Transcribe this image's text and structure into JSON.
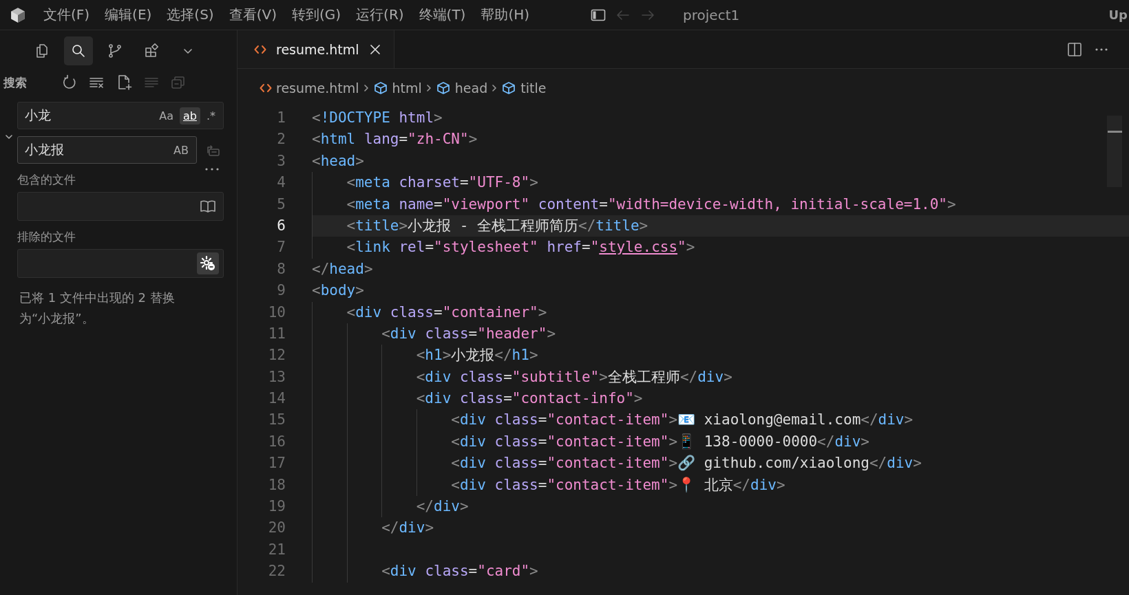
{
  "menu_bar": {
    "items": [
      "文件(F)",
      "编辑(E)",
      "选择(S)",
      "查看(V)",
      "转到(G)",
      "运行(R)",
      "终端(T)",
      "帮助(H)"
    ],
    "nav": [
      {
        "kind": "sidebar",
        "disabled": false
      },
      {
        "kind": "back",
        "disabled": true
      },
      {
        "kind": "forward",
        "disabled": true
      }
    ],
    "title": "project1",
    "account": "Up"
  },
  "activity_bar": [
    {
      "kind": "explorer",
      "selected": false
    },
    {
      "kind": "search",
      "selected": true
    },
    {
      "kind": "source_control",
      "selected": false
    },
    {
      "kind": "extensions",
      "selected": false
    },
    {
      "kind": "more",
      "selected": false
    }
  ],
  "search_panel": {
    "title": "搜索",
    "actions": [
      {
        "kind": "refresh",
        "disabled": false
      },
      {
        "kind": "clear",
        "disabled": false
      },
      {
        "kind": "new_file",
        "disabled": false
      },
      {
        "kind": "collapse",
        "disabled": true
      },
      {
        "kind": "expand",
        "disabled": true
      }
    ],
    "replace_expanded": true,
    "search": {
      "value": "小龙",
      "options": [
        {
          "label": "Aa",
          "on": false
        },
        {
          "label": "ab",
          "on": true
        },
        {
          "label": ".*",
          "on": false
        }
      ]
    },
    "replace": {
      "value": "小龙报",
      "options": [
        {
          "label": "AB",
          "on": false
        }
      ],
      "replace_all_disabled": true
    },
    "include": {
      "label": "包含的文件",
      "open_editors_only": false
    },
    "exclude": {
      "label": "排除的文件",
      "use_exclude_settings": true
    },
    "message": "已将 1 文件中出现的 2 替换为“小龙报”。"
  },
  "editor": {
    "tabs": [
      {
        "label": "resume.html",
        "selected": true
      }
    ],
    "breadcrumbs": [
      {
        "kind": "file",
        "label": "resume.html"
      },
      {
        "kind": "element",
        "label": "html"
      },
      {
        "kind": "element",
        "label": "head"
      },
      {
        "kind": "element",
        "label": "title"
      }
    ],
    "lines": [
      {
        "number": "1",
        "current": false,
        "tokens": [
          {
            "kind": "punct",
            "text": "<"
          },
          {
            "kind": "tag",
            "text": "!DOCTYPE"
          },
          {
            "kind": "attr",
            "text": " html"
          },
          {
            "kind": "punct",
            "text": ">"
          }
        ]
      },
      {
        "number": "2",
        "current": false,
        "tokens": [
          {
            "kind": "punct",
            "text": "<"
          },
          {
            "kind": "tag",
            "text": "html"
          },
          {
            "kind": "attr",
            "text": " lang"
          },
          {
            "kind": "plain",
            "text": "="
          },
          {
            "kind": "string",
            "text": "\"zh-CN\""
          },
          {
            "kind": "punct",
            "text": ">"
          }
        ]
      },
      {
        "number": "3",
        "current": false,
        "tokens": [
          {
            "kind": "punct",
            "text": "<"
          },
          {
            "kind": "tag",
            "text": "head"
          },
          {
            "kind": "punct",
            "text": ">"
          }
        ],
        "children": [
          {
            "number": "4",
            "current": false,
            "tokens": [
              {
                "kind": "punct",
                "text": "<"
              },
              {
                "kind": "tag",
                "text": "meta"
              },
              {
                "kind": "attr",
                "text": " charset"
              },
              {
                "kind": "plain",
                "text": "="
              },
              {
                "kind": "string",
                "text": "\"UTF-8\""
              },
              {
                "kind": "punct",
                "text": ">"
              }
            ]
          },
          {
            "number": "5",
            "current": false,
            "tokens": [
              {
                "kind": "punct",
                "text": "<"
              },
              {
                "kind": "tag",
                "text": "meta"
              },
              {
                "kind": "attr",
                "text": " name"
              },
              {
                "kind": "plain",
                "text": "="
              },
              {
                "kind": "string",
                "text": "\"viewport\""
              },
              {
                "kind": "attr",
                "text": " content"
              },
              {
                "kind": "plain",
                "text": "="
              },
              {
                "kind": "string",
                "text": "\"width=device-width, initial-scale=1.0\""
              },
              {
                "kind": "punct",
                "text": ">"
              }
            ]
          },
          {
            "number": "6",
            "current": true,
            "tokens": [
              {
                "kind": "punct",
                "text": "<"
              },
              {
                "kind": "tag",
                "text": "title"
              },
              {
                "kind": "punct",
                "text": ">"
              },
              {
                "kind": "plain",
                "text": "小龙报 - 全栈工程师简历"
              },
              {
                "kind": "punct",
                "text": "</"
              },
              {
                "kind": "tag",
                "text": "title"
              },
              {
                "kind": "punct",
                "text": ">"
              }
            ]
          },
          {
            "number": "7",
            "current": false,
            "tokens": [
              {
                "kind": "punct",
                "text": "<"
              },
              {
                "kind": "tag",
                "text": "link"
              },
              {
                "kind": "attr",
                "text": " rel"
              },
              {
                "kind": "plain",
                "text": "="
              },
              {
                "kind": "string",
                "text": "\"stylesheet\""
              },
              {
                "kind": "attr",
                "text": " href"
              },
              {
                "kind": "plain",
                "text": "="
              },
              {
                "kind": "string",
                "text": "\""
              },
              {
                "kind": "link",
                "text": "style.css"
              },
              {
                "kind": "string",
                "text": "\""
              },
              {
                "kind": "punct",
                "text": ">"
              }
            ]
          }
        ]
      },
      {
        "number": "8",
        "current": false,
        "tokens": [
          {
            "kind": "punct",
            "text": "</"
          },
          {
            "kind": "tag",
            "text": "head"
          },
          {
            "kind": "punct",
            "text": ">"
          }
        ]
      },
      {
        "number": "9",
        "current": false,
        "tokens": [
          {
            "kind": "punct",
            "text": "<"
          },
          {
            "kind": "tag",
            "text": "body"
          },
          {
            "kind": "punct",
            "text": ">"
          }
        ],
        "children": [
          {
            "number": "10",
            "current": false,
            "tokens": [
              {
                "kind": "punct",
                "text": "<"
              },
              {
                "kind": "tag",
                "text": "div"
              },
              {
                "kind": "attr",
                "text": " class"
              },
              {
                "kind": "plain",
                "text": "="
              },
              {
                "kind": "string",
                "text": "\"container\""
              },
              {
                "kind": "punct",
                "text": ">"
              }
            ],
            "children": [
              {
                "number": "11",
                "current": false,
                "tokens": [
                  {
                    "kind": "punct",
                    "text": "<"
                  },
                  {
                    "kind": "tag",
                    "text": "div"
                  },
                  {
                    "kind": "attr",
                    "text": " class"
                  },
                  {
                    "kind": "plain",
                    "text": "="
                  },
                  {
                    "kind": "string",
                    "text": "\"header\""
                  },
                  {
                    "kind": "punct",
                    "text": ">"
                  }
                ],
                "children": [
                  {
                    "number": "12",
                    "current": false,
                    "tokens": [
                      {
                        "kind": "punct",
                        "text": "<"
                      },
                      {
                        "kind": "tag",
                        "text": "h1"
                      },
                      {
                        "kind": "punct",
                        "text": ">"
                      },
                      {
                        "kind": "plain",
                        "text": "小龙报"
                      },
                      {
                        "kind": "punct",
                        "text": "</"
                      },
                      {
                        "kind": "tag",
                        "text": "h1"
                      },
                      {
                        "kind": "punct",
                        "text": ">"
                      }
                    ]
                  },
                  {
                    "number": "13",
                    "current": false,
                    "tokens": [
                      {
                        "kind": "punct",
                        "text": "<"
                      },
                      {
                        "kind": "tag",
                        "text": "div"
                      },
                      {
                        "kind": "attr",
                        "text": " class"
                      },
                      {
                        "kind": "plain",
                        "text": "="
                      },
                      {
                        "kind": "string",
                        "text": "\"subtitle\""
                      },
                      {
                        "kind": "punct",
                        "text": ">"
                      },
                      {
                        "kind": "plain",
                        "text": "全栈工程师"
                      },
                      {
                        "kind": "punct",
                        "text": "</"
                      },
                      {
                        "kind": "tag",
                        "text": "div"
                      },
                      {
                        "kind": "punct",
                        "text": ">"
                      }
                    ]
                  },
                  {
                    "number": "14",
                    "current": false,
                    "tokens": [
                      {
                        "kind": "punct",
                        "text": "<"
                      },
                      {
                        "kind": "tag",
                        "text": "div"
                      },
                      {
                        "kind": "attr",
                        "text": " class"
                      },
                      {
                        "kind": "plain",
                        "text": "="
                      },
                      {
                        "kind": "string",
                        "text": "\"contact-info\""
                      },
                      {
                        "kind": "punct",
                        "text": ">"
                      }
                    ],
                    "children": [
                      {
                        "number": "15",
                        "current": false,
                        "tokens": [
                          {
                            "kind": "punct",
                            "text": "<"
                          },
                          {
                            "kind": "tag",
                            "text": "div"
                          },
                          {
                            "kind": "attr",
                            "text": " class"
                          },
                          {
                            "kind": "plain",
                            "text": "="
                          },
                          {
                            "kind": "string",
                            "text": "\"contact-item\""
                          },
                          {
                            "kind": "punct",
                            "text": ">"
                          },
                          {
                            "kind": "plain",
                            "text": "📧 xiaolong@email.com"
                          },
                          {
                            "kind": "punct",
                            "text": "</"
                          },
                          {
                            "kind": "tag",
                            "text": "div"
                          },
                          {
                            "kind": "punct",
                            "text": ">"
                          }
                        ]
                      },
                      {
                        "number": "16",
                        "current": false,
                        "tokens": [
                          {
                            "kind": "punct",
                            "text": "<"
                          },
                          {
                            "kind": "tag",
                            "text": "div"
                          },
                          {
                            "kind": "attr",
                            "text": " class"
                          },
                          {
                            "kind": "plain",
                            "text": "="
                          },
                          {
                            "kind": "string",
                            "text": "\"contact-item\""
                          },
                          {
                            "kind": "punct",
                            "text": ">"
                          },
                          {
                            "kind": "plain",
                            "text": "📱 138-0000-0000"
                          },
                          {
                            "kind": "punct",
                            "text": "</"
                          },
                          {
                            "kind": "tag",
                            "text": "div"
                          },
                          {
                            "kind": "punct",
                            "text": ">"
                          }
                        ]
                      },
                      {
                        "number": "17",
                        "current": false,
                        "tokens": [
                          {
                            "kind": "punct",
                            "text": "<"
                          },
                          {
                            "kind": "tag",
                            "text": "div"
                          },
                          {
                            "kind": "attr",
                            "text": " class"
                          },
                          {
                            "kind": "plain",
                            "text": "="
                          },
                          {
                            "kind": "string",
                            "text": "\"contact-item\""
                          },
                          {
                            "kind": "punct",
                            "text": ">"
                          },
                          {
                            "kind": "plain",
                            "text": "🔗 github.com/xiaolong"
                          },
                          {
                            "kind": "punct",
                            "text": "</"
                          },
                          {
                            "kind": "tag",
                            "text": "div"
                          },
                          {
                            "kind": "punct",
                            "text": ">"
                          }
                        ]
                      },
                      {
                        "number": "18",
                        "current": false,
                        "tokens": [
                          {
                            "kind": "punct",
                            "text": "<"
                          },
                          {
                            "kind": "tag",
                            "text": "div"
                          },
                          {
                            "kind": "attr",
                            "text": " class"
                          },
                          {
                            "kind": "plain",
                            "text": "="
                          },
                          {
                            "kind": "string",
                            "text": "\"contact-item\""
                          },
                          {
                            "kind": "punct",
                            "text": ">"
                          },
                          {
                            "kind": "plain",
                            "text": "📍 北京"
                          },
                          {
                            "kind": "punct",
                            "text": "</"
                          },
                          {
                            "kind": "tag",
                            "text": "div"
                          },
                          {
                            "kind": "punct",
                            "text": ">"
                          }
                        ]
                      }
                    ]
                  },
                  {
                    "number": "19",
                    "current": false,
                    "tokens": [
                      {
                        "kind": "punct",
                        "text": "</"
                      },
                      {
                        "kind": "tag",
                        "text": "div"
                      },
                      {
                        "kind": "punct",
                        "text": ">"
                      }
                    ]
                  }
                ]
              },
              {
                "number": "20",
                "current": false,
                "tokens": [
                  {
                    "kind": "punct",
                    "text": "</"
                  },
                  {
                    "kind": "tag",
                    "text": "div"
                  },
                  {
                    "kind": "punct",
                    "text": ">"
                  }
                ]
              },
              {
                "number": "21",
                "current": false
              },
              {
                "number": "22",
                "current": false,
                "tokens": [
                  {
                    "kind": "punct",
                    "text": "<"
                  },
                  {
                    "kind": "tag",
                    "text": "div"
                  },
                  {
                    "kind": "attr",
                    "text": " class"
                  },
                  {
                    "kind": "plain",
                    "text": "="
                  },
                  {
                    "kind": "string",
                    "text": "\"card\""
                  },
                  {
                    "kind": "punct",
                    "text": ">"
                  }
                ]
              }
            ]
          }
        ]
      }
    ]
  }
}
